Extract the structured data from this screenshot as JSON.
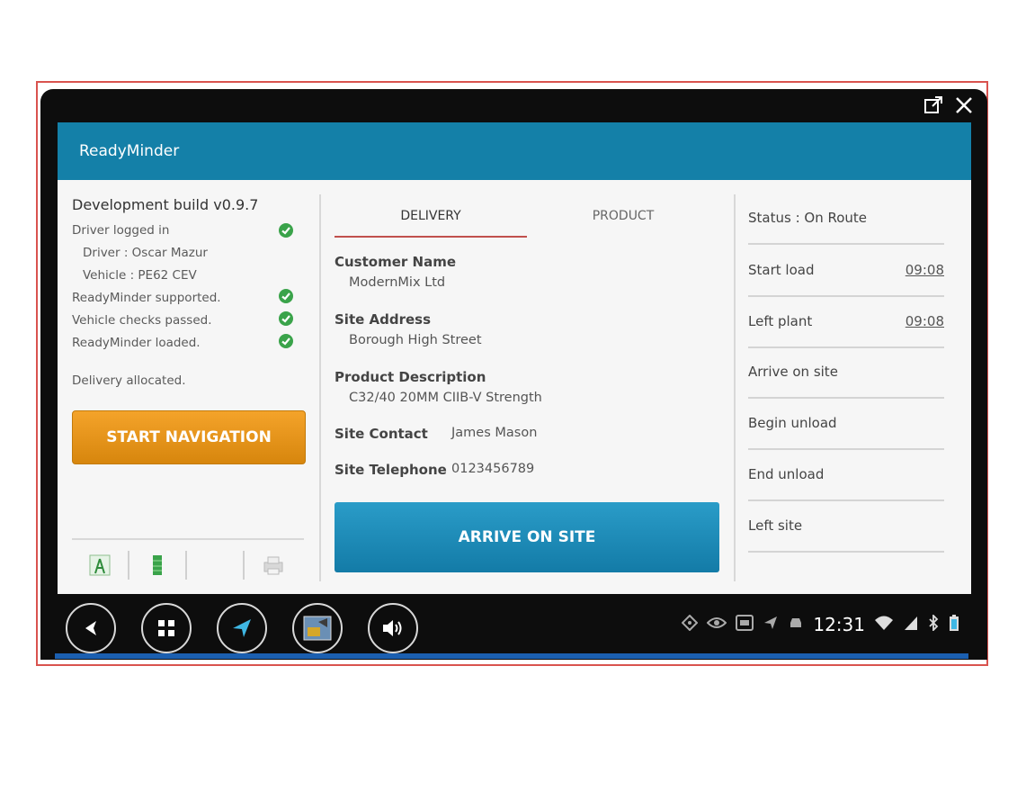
{
  "app": {
    "title": "ReadyMinder"
  },
  "left": {
    "build": "Development build v0.9.7",
    "lines": [
      {
        "text": "Driver logged in",
        "check": true
      },
      {
        "text": "Driver    : Oscar Mazur",
        "check": false
      },
      {
        "text": "Vehicle : PE62 CEV",
        "check": false
      },
      {
        "text": "ReadyMinder supported.",
        "check": true
      },
      {
        "text": "Vehicle checks passed.",
        "check": true
      },
      {
        "text": "ReadyMinder loaded.",
        "check": true
      }
    ],
    "delivery_status": "Delivery allocated.",
    "start_nav_label": "START NAVIGATION"
  },
  "middle": {
    "tabs": [
      "DELIVERY",
      "PRODUCT"
    ],
    "customer_label": "Customer Name",
    "customer_value": "ModernMix Ltd",
    "site_address_label": "Site Address",
    "site_address_value": "Borough High Street",
    "product_label": "Product Description",
    "product_value": "C32/40 20MM CIIB-V Strength",
    "contact_label": "Site Contact",
    "contact_value": "James Mason",
    "telephone_label": "Site Telephone",
    "telephone_value": "0123456789",
    "arrive_label": "ARRIVE ON SITE"
  },
  "right": {
    "status": "Status :  On Route",
    "rows": [
      {
        "label": "Start load",
        "time": "09:08"
      },
      {
        "label": "Left plant",
        "time": "09:08"
      },
      {
        "label": "Arrive on site",
        "time": ""
      },
      {
        "label": "Begin unload",
        "time": ""
      },
      {
        "label": "End unload",
        "time": ""
      },
      {
        "label": "Left site",
        "time": ""
      }
    ]
  },
  "system": {
    "clock": "12:31"
  },
  "icons": {
    "check": "check-circle-icon",
    "external": "external-link-icon",
    "close": "close-icon",
    "back": "back-arrow-icon",
    "apps": "apps-grid-icon",
    "navigate": "navigation-arrow-icon",
    "gallery": "gallery-thumbnail-icon",
    "volume": "volume-icon"
  },
  "colors": {
    "appbar": "#1480a8",
    "start_nav": "#e99a1c",
    "arrive": "#1d8dbb",
    "check": "#3aa34a"
  }
}
